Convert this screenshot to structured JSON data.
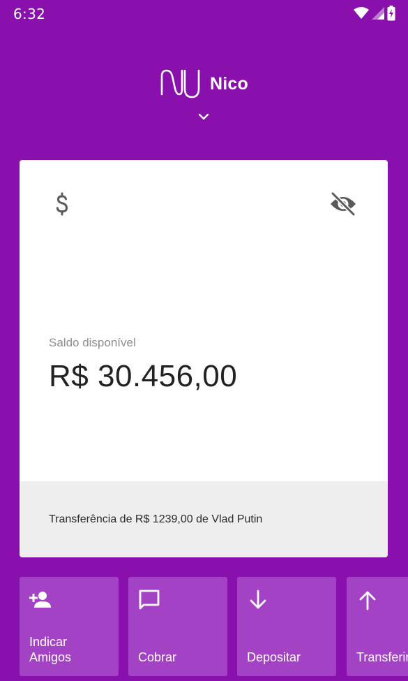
{
  "status_bar": {
    "time": "6:32",
    "icons": [
      "wifi-icon",
      "signal-icon",
      "battery-charging-icon"
    ]
  },
  "header": {
    "logo": "nu-logo",
    "user_name": "Nico",
    "expand_icon": "chevron-down-icon"
  },
  "card": {
    "currency_icon": "dollar-icon",
    "visibility_icon": "eye-off-icon",
    "balance_label": "Saldo disponível",
    "balance_value": "R$ 30.456,00",
    "last_transaction": "Transferência de R$ 1239,00 de Vlad Putin"
  },
  "actions": [
    {
      "icon": "person-add-icon",
      "label_line1": "Indicar",
      "label_line2": "Amigos"
    },
    {
      "icon": "chat-bubble-icon",
      "label_line1": "",
      "label_line2": "Cobrar"
    },
    {
      "icon": "arrow-down-icon",
      "label_line1": "",
      "label_line2": "Depositar"
    },
    {
      "icon": "arrow-up-icon",
      "label_line1": "",
      "label_line2": "Transferir"
    }
  ],
  "colors": {
    "background": "#8a10ae",
    "tile": "#a442c6",
    "card": "#ffffff",
    "card_footer": "#eeeeee"
  }
}
